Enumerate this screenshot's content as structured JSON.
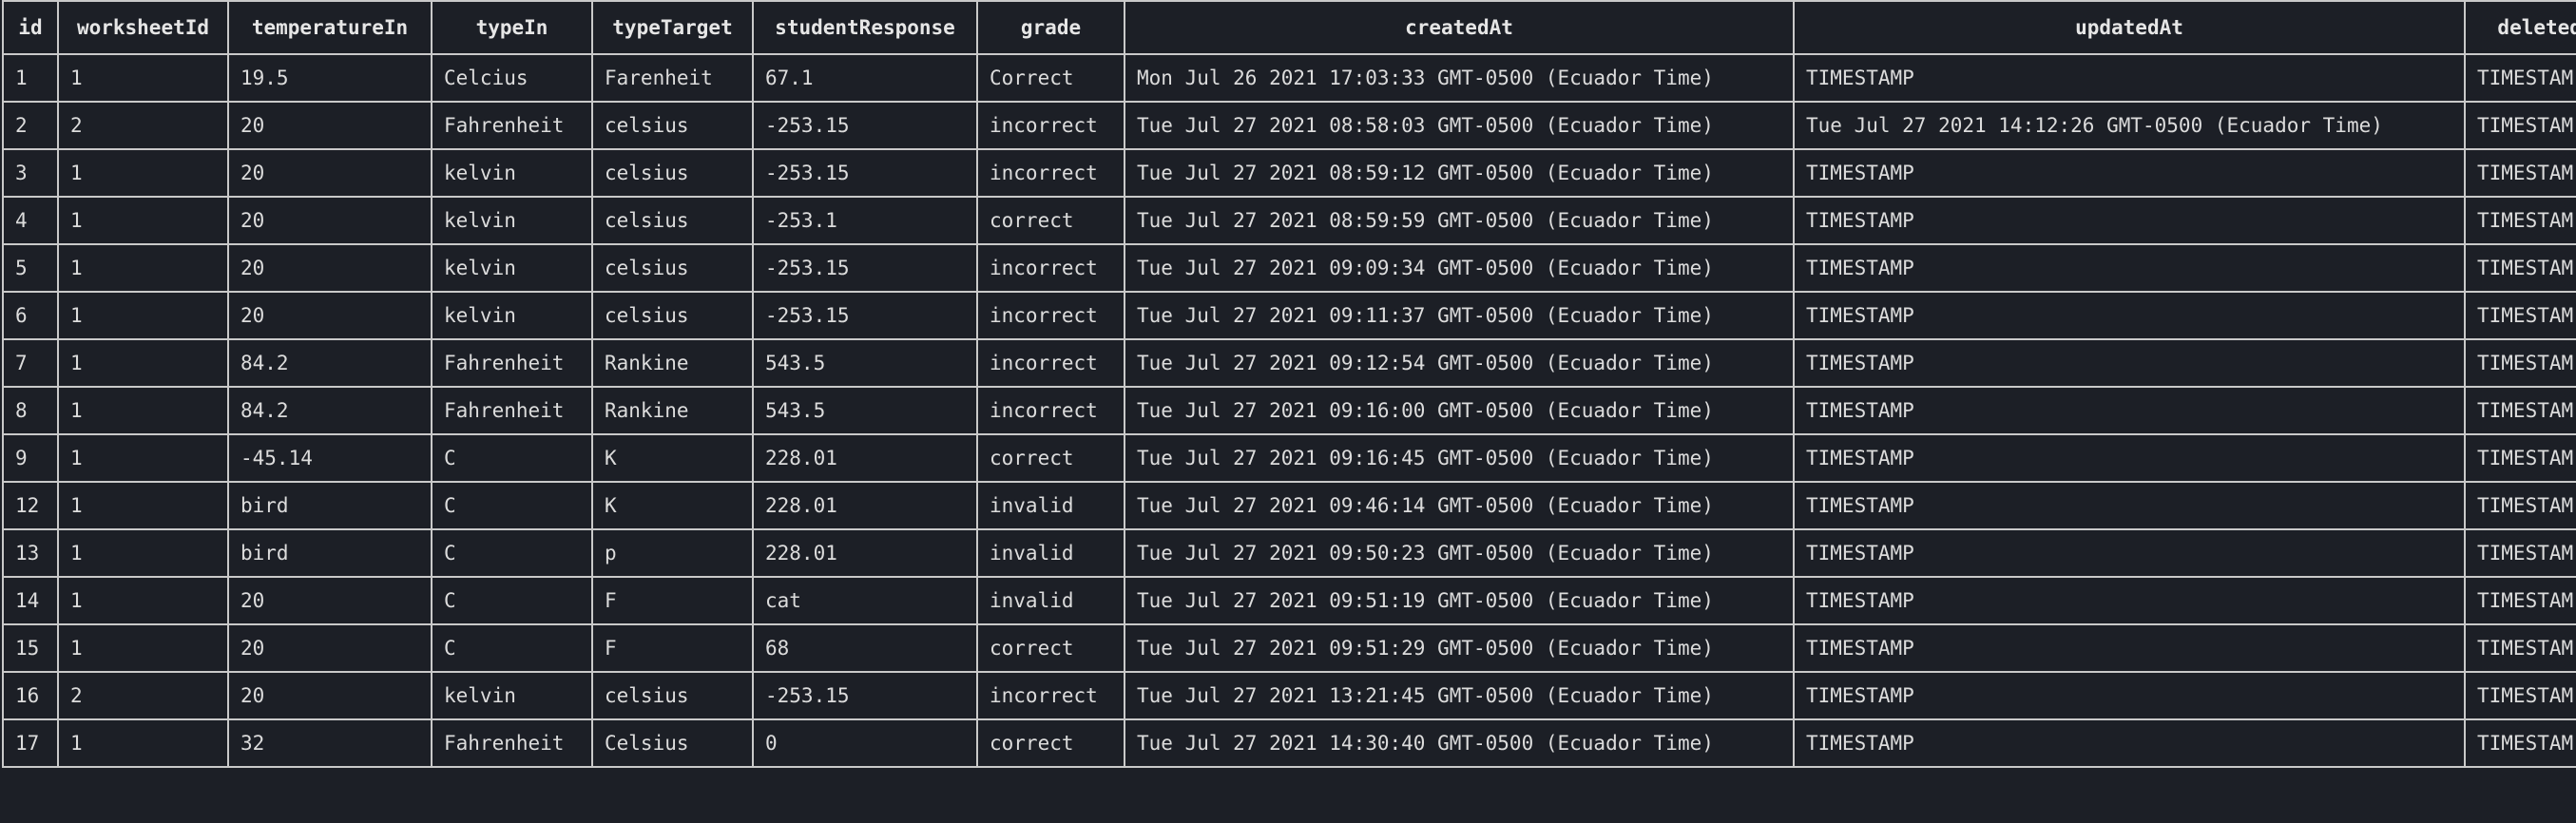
{
  "columns": [
    "id",
    "worksheetId",
    "temperatureIn",
    "typeIn",
    "typeTarget",
    "studentResponse",
    "grade",
    "createdAt",
    "updatedAt",
    "deletedA"
  ],
  "rows": [
    [
      "1",
      "1",
      "19.5",
      "Celcius",
      "Farenheit",
      "67.1",
      "Correct",
      "Mon Jul 26 2021 17:03:33 GMT-0500 (Ecuador Time)",
      "TIMESTAMP",
      "TIMESTAM"
    ],
    [
      "2",
      "2",
      "20",
      "Fahrenheit",
      "celsius",
      "-253.15",
      "incorrect",
      "Tue Jul 27 2021 08:58:03 GMT-0500 (Ecuador Time)",
      "Tue Jul 27 2021 14:12:26 GMT-0500 (Ecuador Time)",
      "TIMESTAM"
    ],
    [
      "3",
      "1",
      "20",
      "kelvin",
      "celsius",
      "-253.15",
      "incorrect",
      "Tue Jul 27 2021 08:59:12 GMT-0500 (Ecuador Time)",
      "TIMESTAMP",
      "TIMESTAM"
    ],
    [
      "4",
      "1",
      "20",
      "kelvin",
      "celsius",
      "-253.1",
      "correct",
      "Tue Jul 27 2021 08:59:59 GMT-0500 (Ecuador Time)",
      "TIMESTAMP",
      "TIMESTAM"
    ],
    [
      "5",
      "1",
      "20",
      "kelvin",
      "celsius",
      "-253.15",
      "incorrect",
      "Tue Jul 27 2021 09:09:34 GMT-0500 (Ecuador Time)",
      "TIMESTAMP",
      "TIMESTAM"
    ],
    [
      "6",
      "1",
      "20",
      "kelvin",
      "celsius",
      "-253.15",
      "incorrect",
      "Tue Jul 27 2021 09:11:37 GMT-0500 (Ecuador Time)",
      "TIMESTAMP",
      "TIMESTAM"
    ],
    [
      "7",
      "1",
      "84.2",
      "Fahrenheit",
      "Rankine",
      "543.5",
      "incorrect",
      "Tue Jul 27 2021 09:12:54 GMT-0500 (Ecuador Time)",
      "TIMESTAMP",
      "TIMESTAM"
    ],
    [
      "8",
      "1",
      "84.2",
      "Fahrenheit",
      "Rankine",
      "543.5",
      "incorrect",
      "Tue Jul 27 2021 09:16:00 GMT-0500 (Ecuador Time)",
      "TIMESTAMP",
      "TIMESTAM"
    ],
    [
      "9",
      "1",
      "-45.14",
      "C",
      "K",
      "228.01",
      "correct",
      "Tue Jul 27 2021 09:16:45 GMT-0500 (Ecuador Time)",
      "TIMESTAMP",
      "TIMESTAM"
    ],
    [
      "12",
      "1",
      "bird",
      "C",
      "K",
      "228.01",
      "invalid",
      "Tue Jul 27 2021 09:46:14 GMT-0500 (Ecuador Time)",
      "TIMESTAMP",
      "TIMESTAM"
    ],
    [
      "13",
      "1",
      "bird",
      "C",
      "p",
      "228.01",
      "invalid",
      "Tue Jul 27 2021 09:50:23 GMT-0500 (Ecuador Time)",
      "TIMESTAMP",
      "TIMESTAM"
    ],
    [
      "14",
      "1",
      "20",
      "C",
      "F",
      "cat",
      "invalid",
      "Tue Jul 27 2021 09:51:19 GMT-0500 (Ecuador Time)",
      "TIMESTAMP",
      "TIMESTAM"
    ],
    [
      "15",
      "1",
      "20",
      "C",
      "F",
      "68",
      "correct",
      "Tue Jul 27 2021 09:51:29 GMT-0500 (Ecuador Time)",
      "TIMESTAMP",
      "TIMESTAM"
    ],
    [
      "16",
      "2",
      "20",
      "kelvin",
      "celsius",
      "-253.15",
      "incorrect",
      "Tue Jul 27 2021 13:21:45 GMT-0500 (Ecuador Time)",
      "TIMESTAMP",
      "TIMESTAM"
    ],
    [
      "17",
      "1",
      "32",
      "Fahrenheit",
      "Celsius",
      "0",
      "correct",
      "Tue Jul 27 2021 14:30:40 GMT-0500 (Ecuador Time)",
      "TIMESTAMP",
      "TIMESTAM"
    ]
  ]
}
